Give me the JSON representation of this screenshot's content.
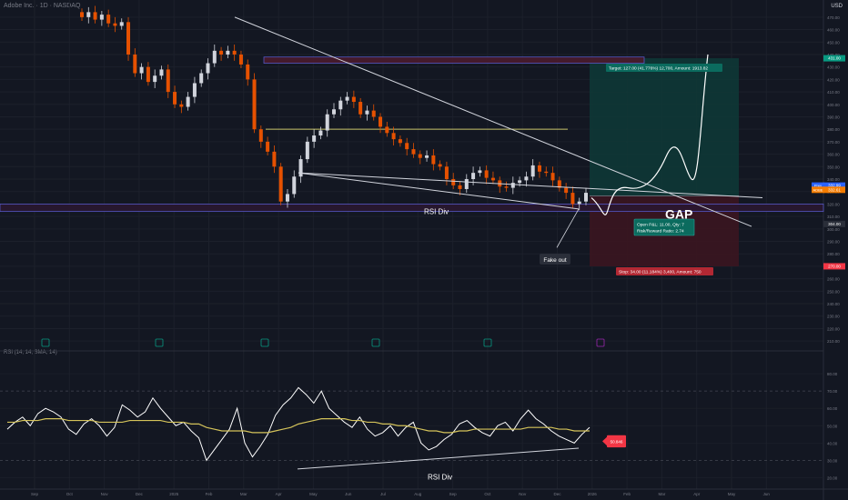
{
  "header": {
    "title": "Adobe Inc. · 1D · NASDAQ",
    "currency": "USD"
  },
  "rsi_pane": {
    "title": "RSI (14, 14, SMA, 14)"
  },
  "chart_data": [
    {
      "type": "candlestick",
      "price_axis_ticks": [
        470,
        460,
        450,
        440,
        430,
        420,
        410,
        400,
        390,
        380,
        370,
        360,
        350,
        340,
        330,
        320,
        310,
        300,
        290,
        280,
        270,
        260,
        250,
        240,
        230,
        220,
        210
      ],
      "ylim": [
        205,
        475
      ],
      "time_axis_labels": [
        "Sep",
        "Oct",
        "Nov",
        "Dec",
        "2025",
        "Feb",
        "Mar",
        "Apr",
        "May",
        "Jun",
        "Jul",
        "Aug",
        "Sep",
        "Oct",
        "Nov",
        "Dec",
        "2026",
        "Feb",
        "Mar",
        "Apr",
        "May",
        "Jun"
      ],
      "closes": [
        470,
        474,
        468,
        472,
        465,
        463,
        466,
        440,
        425,
        430,
        418,
        423,
        428,
        410,
        400,
        398,
        406,
        417,
        425,
        433,
        443,
        440,
        443,
        440,
        432,
        420,
        380,
        370,
        362,
        350,
        322,
        328,
        342,
        356,
        370,
        375,
        379,
        392,
        396,
        403,
        406,
        402,
        392,
        395,
        390,
        382,
        377,
        372,
        369,
        364,
        360,
        357,
        359,
        352,
        350,
        340,
        335,
        332,
        340,
        345,
        347,
        341,
        339,
        334,
        333,
        337,
        339,
        342,
        351,
        346,
        345,
        339,
        333,
        329,
        320,
        322,
        329
      ],
      "annotations": {
        "rsi_div_label": "RSI Div",
        "gap_label": "GAP",
        "fake_out_label": "Fake out",
        "position_open_label": "Open P&L: 11.00, Qty: 7",
        "position_rr_label": "Risk/Reward Ratio: 2.74",
        "target_label": "Target: 127.00 (41.776%) 12,700, Amount: 1913.82",
        "stop_label": "Stop: 34.00 (11.184%) 3,400, Amount: 750"
      },
      "levels": {
        "resistance_zone": [
          433,
          438
        ],
        "mid_line": 380,
        "support_zone": [
          314,
          320
        ],
        "target": 437,
        "entry": 326.5,
        "stop": 270
      },
      "price_tags": [
        {
          "label": "Prev",
          "value": "332.99",
          "color": "#2962ff"
        },
        {
          "label": "ADBE",
          "value": "332.61",
          "color": "#f57c00"
        },
        {
          "label": "",
          "value": "431.00",
          "color": "#089981"
        },
        {
          "label": "",
          "value": "304.00",
          "color": "#2a2e39"
        },
        {
          "label": "",
          "value": "270.00",
          "color": "#f23645"
        }
      ],
      "colors": {
        "up": "#d1d4dc",
        "down": "#e65100",
        "target_zone": "#0e3a37",
        "stop_zone": "#3b1520",
        "resistance_zone": "#4a1b2c",
        "support_zone": "#2a1730"
      }
    },
    {
      "type": "line",
      "name": "RSI",
      "ylim": [
        15,
        90
      ],
      "ticks": [
        80,
        70,
        60,
        50,
        40,
        30,
        20
      ],
      "values": [
        48,
        52,
        55,
        50,
        57,
        60,
        58,
        55,
        48,
        45,
        51,
        54,
        50,
        44,
        49,
        62,
        59,
        55,
        58,
        66,
        60,
        55,
        50,
        52,
        47,
        43,
        30,
        36,
        42,
        48,
        60,
        40,
        32,
        38,
        45,
        56,
        62,
        66,
        72,
        68,
        63,
        70,
        60,
        56,
        52,
        49,
        55,
        48,
        44,
        46,
        50,
        44,
        49,
        52,
        40,
        36,
        38,
        42,
        45,
        51,
        53,
        49,
        46,
        44,
        50,
        52,
        47,
        54,
        59,
        54,
        51,
        47,
        44,
        42,
        40,
        45,
        49
      ],
      "sma": [
        52,
        52,
        53,
        53,
        53,
        54,
        54,
        54,
        53,
        53,
        53,
        53,
        52,
        52,
        52,
        52,
        53,
        53,
        53,
        53,
        53,
        52,
        52,
        52,
        51,
        51,
        49,
        48,
        47,
        47,
        47,
        47,
        46,
        46,
        46,
        47,
        48,
        49,
        51,
        52,
        53,
        54,
        54,
        54,
        54,
        53,
        53,
        52,
        52,
        51,
        51,
        50,
        50,
        49,
        48,
        47,
        47,
        46,
        46,
        47,
        47,
        48,
        48,
        48,
        48,
        48,
        48,
        48,
        49,
        49,
        49,
        49,
        48,
        48,
        47,
        47,
        47
      ],
      "divergence_label": "RSI Div",
      "badge_value": "50.846",
      "colors": {
        "rsi": "#ffffff",
        "sma": "#d4c35a",
        "badge": "#f23645"
      }
    }
  ]
}
